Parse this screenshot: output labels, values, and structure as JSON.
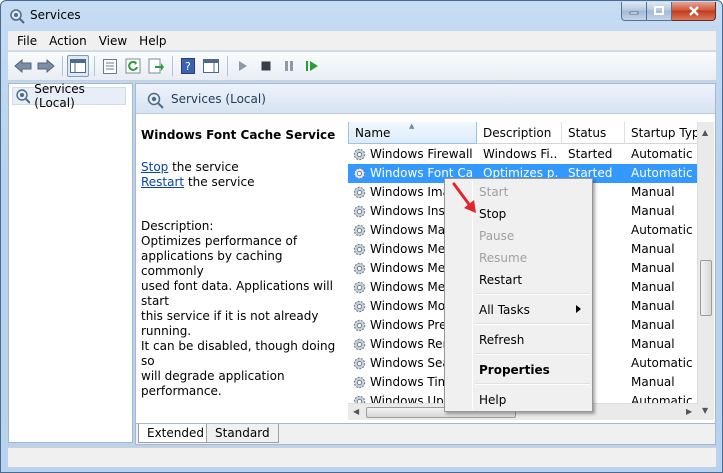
{
  "window": {
    "title": "Services"
  },
  "menubar": {
    "items": [
      "File",
      "Action",
      "View",
      "Help"
    ]
  },
  "tree": {
    "root_label": "Services (Local)"
  },
  "pane": {
    "header": "Services (Local)",
    "service_name": "Windows Font Cache Service",
    "stop_link": "Stop",
    "stop_rest": " the service",
    "restart_link": "Restart",
    "restart_rest": " the service",
    "description_label": "Description:",
    "description_text": "Optimizes performance of\napplications by caching commonly\nused font data. Applications will start\nthis service if it is not already running.\nIt can be disabled, though doing so\nwill degrade application performance."
  },
  "list": {
    "columns": [
      "Name",
      "Description",
      "Status",
      "Startup Type"
    ],
    "rows": [
      {
        "name": "Windows Firewall",
        "description": "Windows Fi...",
        "status": "Started",
        "startup": "Automatic"
      },
      {
        "name": "Windows Font Ca...",
        "description": "Optimizes p...",
        "status": "Started",
        "startup": "Automatic (",
        "selected": true
      },
      {
        "name": "Windows Imag",
        "description": "",
        "status": "",
        "startup": "Manual"
      },
      {
        "name": "Windows Insta",
        "description": "",
        "status": "",
        "startup": "Manual"
      },
      {
        "name": "Windows Man",
        "description": "",
        "status": "ed",
        "startup": "Automatic"
      },
      {
        "name": "Windows Med",
        "description": "",
        "status": "",
        "startup": "Manual"
      },
      {
        "name": "Windows Med",
        "description": "",
        "status": "",
        "startup": "Manual"
      },
      {
        "name": "Windows Med",
        "description": "",
        "status": "",
        "startup": "Manual"
      },
      {
        "name": "Windows Moc",
        "description": "",
        "status": "",
        "startup": "Manual"
      },
      {
        "name": "Windows Pres",
        "description": "",
        "status": "",
        "startup": "Manual"
      },
      {
        "name": "Windows Rem",
        "description": "",
        "status": "",
        "startup": "Manual"
      },
      {
        "name": "Windows Sear",
        "description": "",
        "status": "ed",
        "startup": "Automatic ("
      },
      {
        "name": "Windows Time",
        "description": "",
        "status": "",
        "startup": "Manual"
      },
      {
        "name": "Windows Upd",
        "description": "",
        "status": "ed",
        "startup": "Automatic ("
      }
    ]
  },
  "tabs": [
    "Extended",
    "Standard"
  ],
  "context_menu": {
    "items": [
      {
        "label": "Start",
        "disabled": true
      },
      {
        "label": "Stop",
        "disabled": false
      },
      {
        "label": "Pause",
        "disabled": true
      },
      {
        "label": "Resume",
        "disabled": true
      },
      {
        "label": "Restart",
        "disabled": false
      },
      {
        "label": "All Tasks",
        "disabled": false,
        "submenu": true
      },
      {
        "label": "Refresh",
        "disabled": false
      },
      {
        "label": "Properties",
        "disabled": false,
        "bold": true
      },
      {
        "label": "Help",
        "disabled": false
      }
    ]
  },
  "colors": {
    "selection": "#3399ff",
    "link": "#0645ad",
    "annotation_arrow": "#e0262b"
  }
}
